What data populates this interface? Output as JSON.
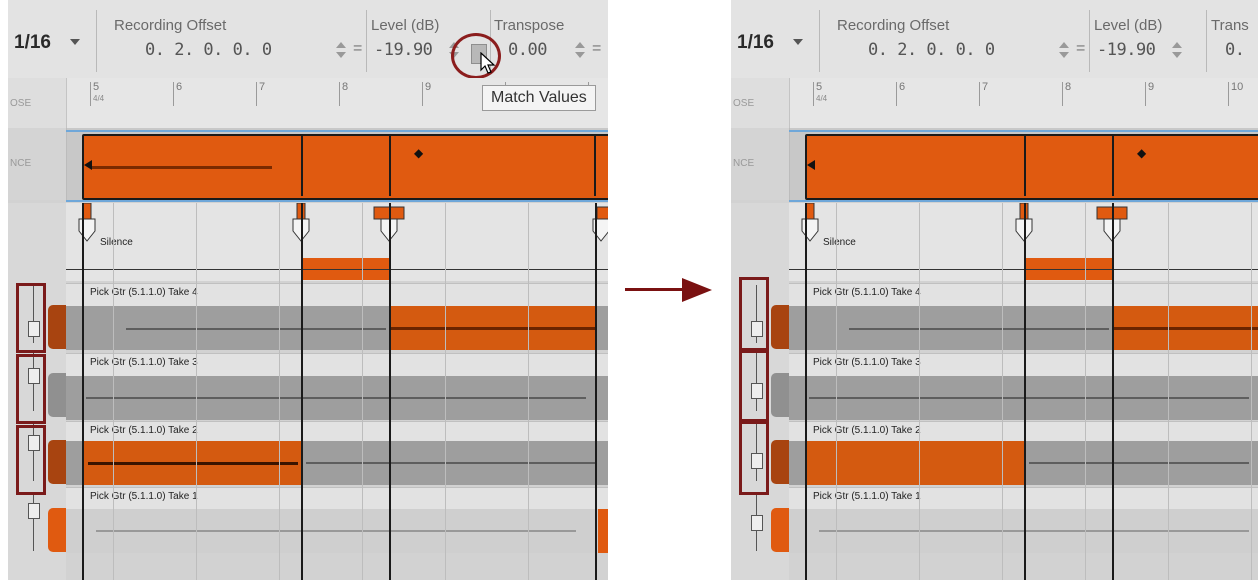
{
  "toolbar": {
    "snap_value": "1/16",
    "recording_offset_label": "Recording Offset",
    "recording_offset_value": "0. 2. 0. 0. 0",
    "level_label": "Level (dB)",
    "level_value": "-19.90",
    "transpose_label": "Transpose",
    "transpose_value": "0.00",
    "transpose_label_cut": "Trans",
    "transpose_value_cut": "0."
  },
  "tooltip": {
    "text": "Match Values"
  },
  "ruler": {
    "bars": [
      "5",
      "6",
      "7",
      "8",
      "9",
      "10"
    ],
    "time_signature": "4/4",
    "side_label": "OSE"
  },
  "comp_track": {
    "side_label": "NCE"
  },
  "silence_label": "Silence",
  "takes": [
    "Pick Gtr (5.1.1.0) Take 4",
    "Pick Gtr (5.1.1.0) Take 3",
    "Pick Gtr (5.1.1.0) Take 2",
    "Pick Gtr (5.1.1.0) Take 1"
  ],
  "colors": {
    "accent_orange": "#e05a10",
    "lane_gray": "#9e9e9e",
    "highlight_red": "#7a1a1a"
  },
  "icons": [
    "chevron-down-icon",
    "spinner-icon",
    "match-values-icon",
    "cursor-icon",
    "fader-icon",
    "comp-marker-icon",
    "arrow-right-icon"
  ]
}
